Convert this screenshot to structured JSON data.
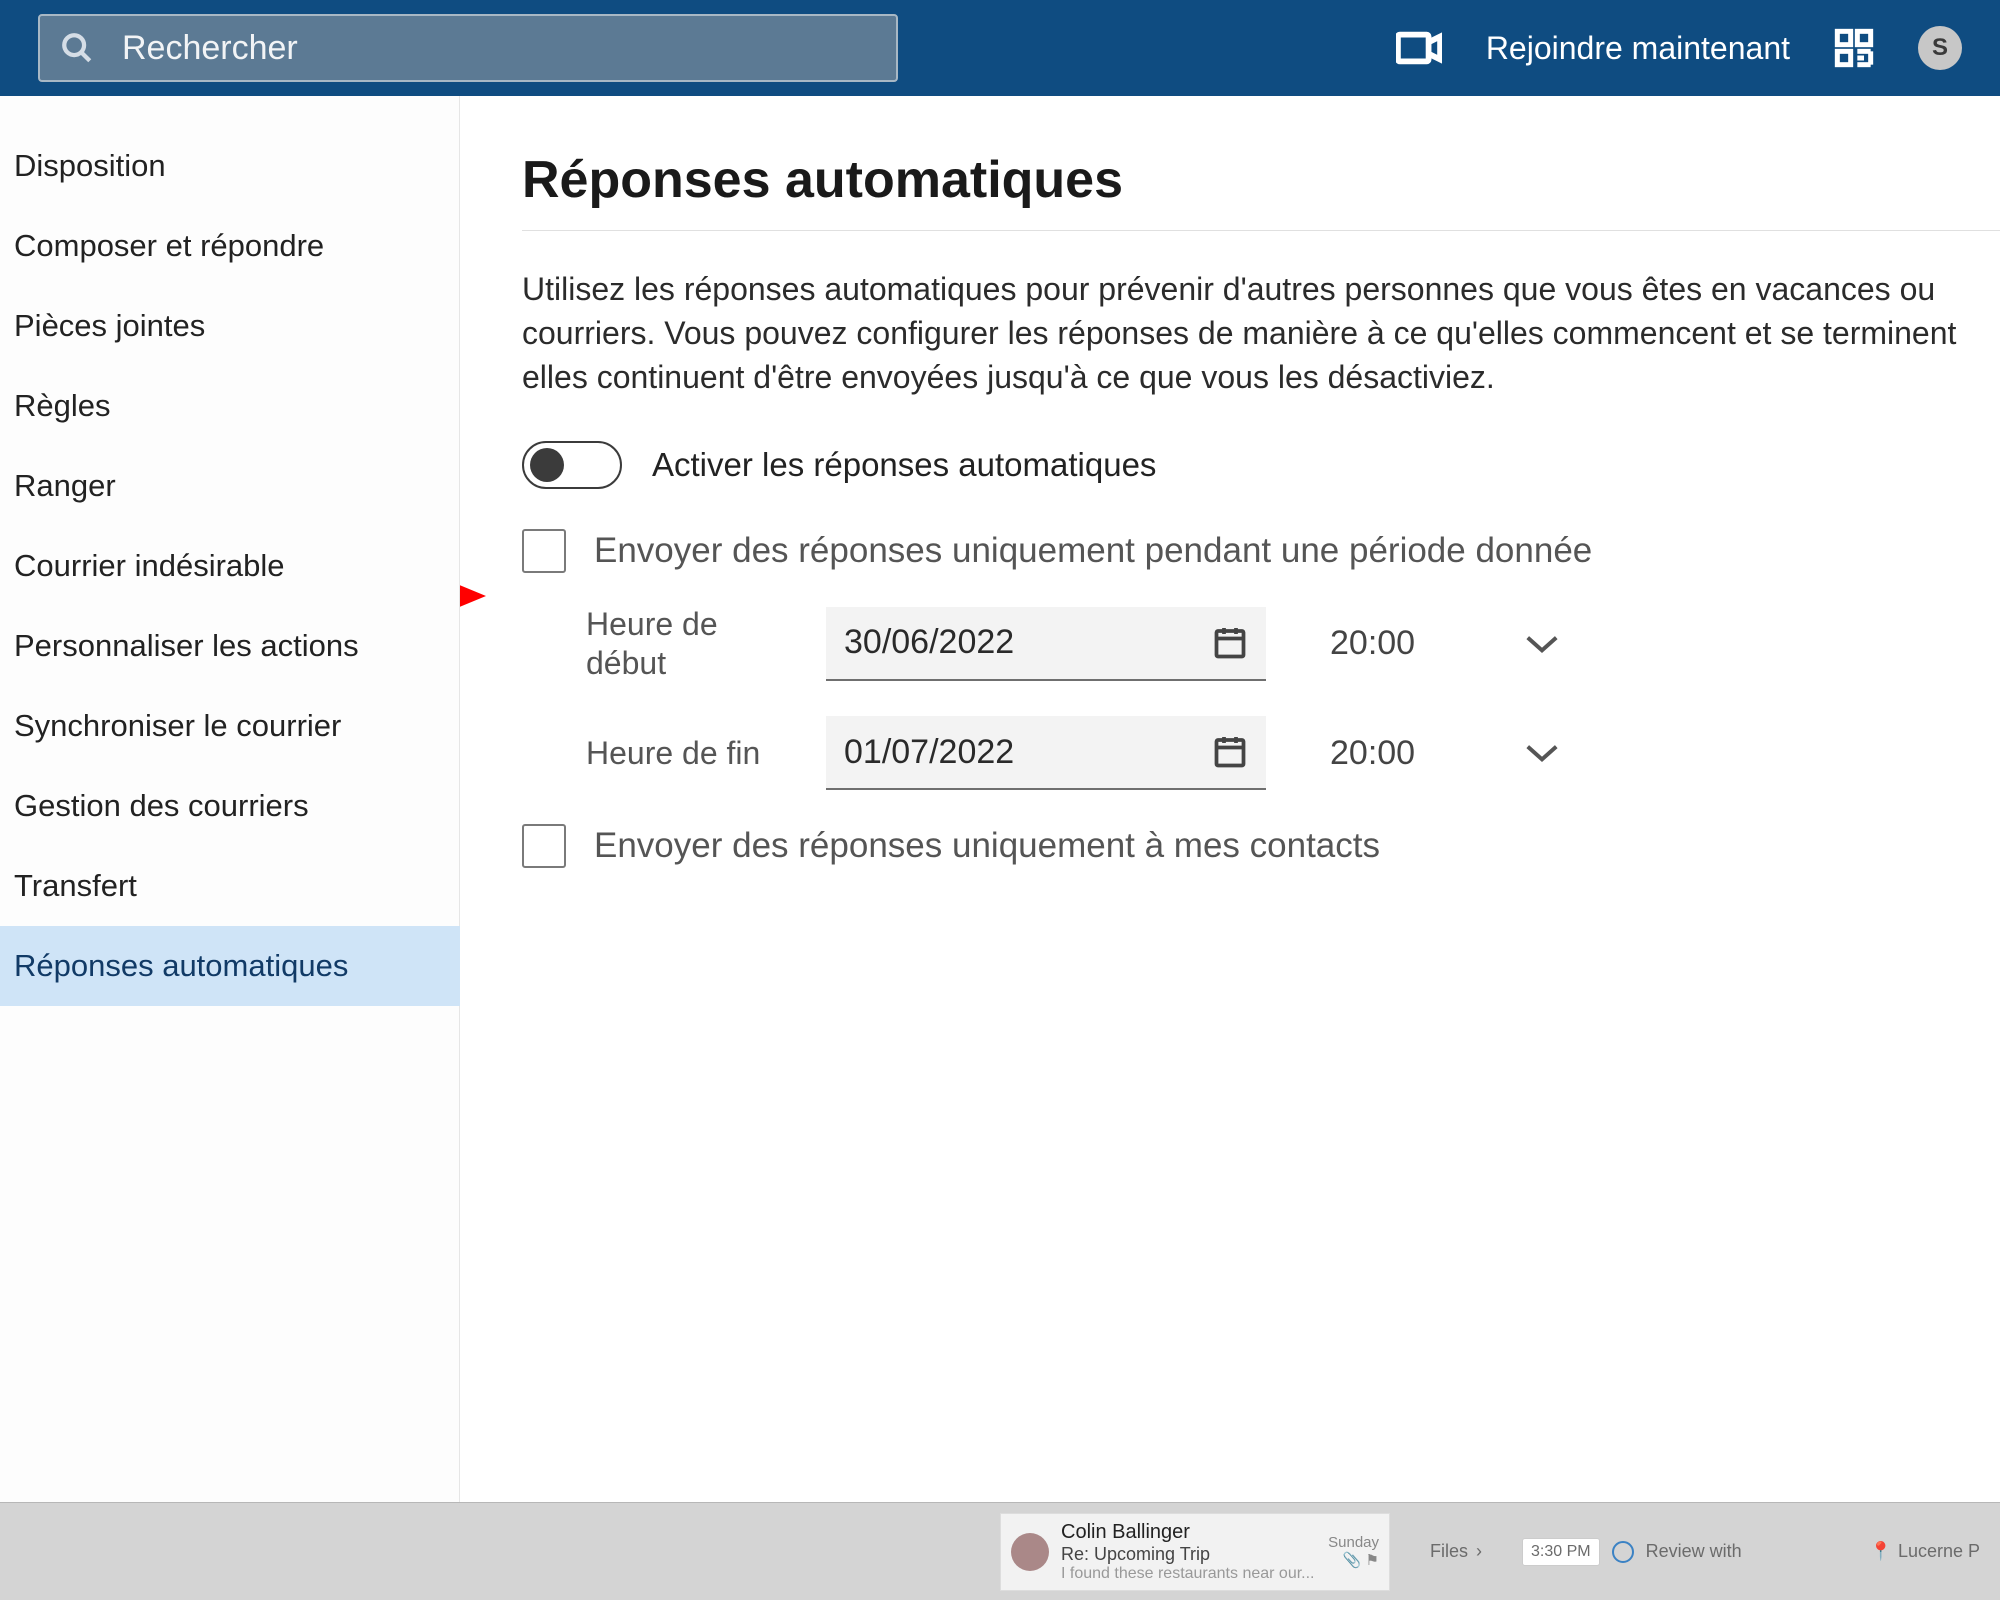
{
  "header": {
    "search_placeholder": "Rechercher",
    "join_label": "Rejoindre maintenant",
    "avatar_letter": "S"
  },
  "sidebar": {
    "items": [
      {
        "label": "Disposition",
        "active": false
      },
      {
        "label": "Composer et répondre",
        "active": false
      },
      {
        "label": "Pièces jointes",
        "active": false
      },
      {
        "label": "Règles",
        "active": false
      },
      {
        "label": "Ranger",
        "active": false
      },
      {
        "label": "Courrier indésirable",
        "active": false
      },
      {
        "label": "Personnaliser les actions",
        "active": false
      },
      {
        "label": "Synchroniser le courrier",
        "active": false
      },
      {
        "label": "Gestion des courriers",
        "active": false
      },
      {
        "label": "Transfert",
        "active": false
      },
      {
        "label": "Réponses automatiques",
        "active": true
      }
    ]
  },
  "main": {
    "title": "Réponses automatiques",
    "description": "Utilisez les réponses automatiques pour prévenir d'autres personnes que vous êtes en vacances ou courriers. Vous pouvez configurer les réponses de manière à ce qu'elles commencent et se terminent elles continuent d'être envoyées jusqu'à ce que vous les désactiviez.",
    "toggle_label": "Activer les réponses automatiques",
    "period_check_label": "Envoyer des réponses uniquement pendant une période donnée",
    "start_label": "Heure de début",
    "start_date": "30/06/2022",
    "start_time": "20:00",
    "end_label": "Heure de fin",
    "end_date": "01/07/2022",
    "end_time": "20:00",
    "contacts_check_label": "Envoyer des réponses uniquement à mes contacts"
  },
  "bottom": {
    "name": "Colin Ballinger",
    "subject": "Re: Upcoming Trip",
    "preview": "I found these restaurants near our...",
    "day": "Sunday",
    "files_label": "Files",
    "time_chip": "3:30 PM",
    "review_label": "Review with",
    "map_label": "Lucerne P"
  }
}
